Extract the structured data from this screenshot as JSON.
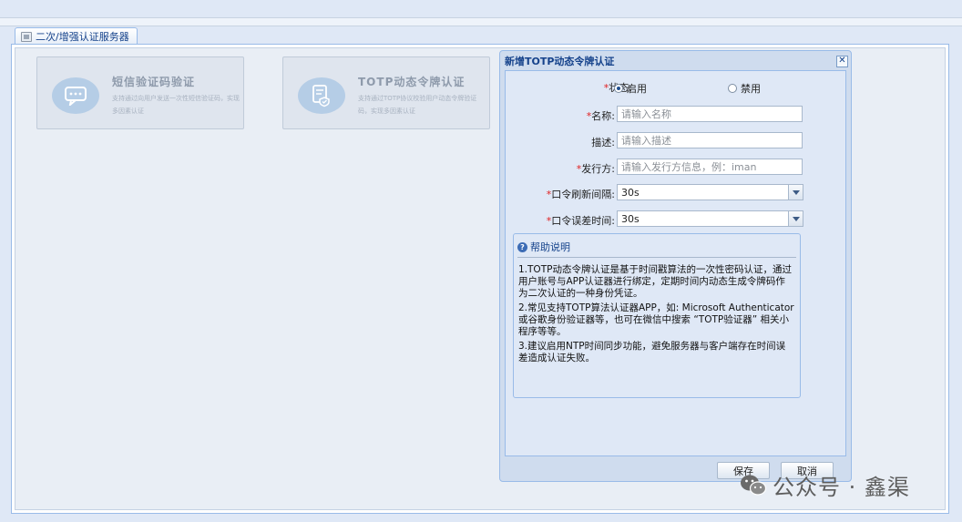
{
  "tab": {
    "label": "二次/增强认证服务器"
  },
  "cards": [
    {
      "title": "短信验证码验证",
      "desc": "支持通过向用户发送一次性短信验证码，实现多因素认证"
    },
    {
      "title": "TOTP动态令牌认证",
      "desc": "支持通过TOTP协议校验用户动态令牌验证码，实现多因素认证"
    }
  ],
  "dialog": {
    "title": "新增TOTP动态令牌认证",
    "status": {
      "label": "状态:",
      "enabled": "启用",
      "disabled": "禁用",
      "selected": "enabled"
    },
    "name": {
      "label": "名称:",
      "placeholder": "请输入名称"
    },
    "description": {
      "label": "描述:",
      "placeholder": "请输入描述"
    },
    "issuer": {
      "label": "发行方:",
      "placeholder": "请输入发行方信息，例：iman"
    },
    "refresh": {
      "label": "口令刷新间隔:",
      "value": "30s"
    },
    "tolerance": {
      "label": "口令误差时间:",
      "value": "30s"
    },
    "help": {
      "title": "帮助说明",
      "items": [
        "1.TOTP动态令牌认证是基于时间戳算法的一次性密码认证，通过用户账号与APP认证器进行绑定，定期时间内动态生成令牌码作为二次认证的一种身份凭证。",
        "2.常见支持TOTP算法认证器APP，如: Microsoft Authenticator 或谷歌身份验证器等，也可在微信中搜索 “TOTP验证器” 相关小程序等等。",
        "3.建议启用NTP时间同步功能，避免服务器与客户端存在时间误差造成认证失败。"
      ]
    },
    "save_label": "保存",
    "cancel_label": "取消"
  },
  "watermark": {
    "text": "公众号 · 鑫渠"
  }
}
